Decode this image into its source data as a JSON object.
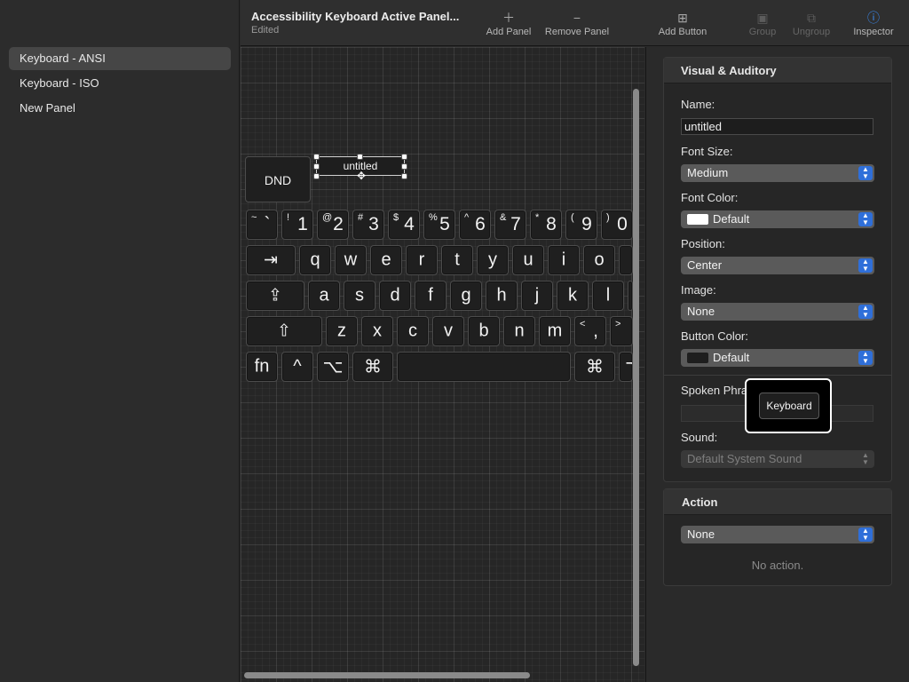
{
  "sidebar": {
    "items": [
      {
        "label": "Keyboard - ANSI",
        "selected": true
      },
      {
        "label": "Keyboard - ISO",
        "selected": false
      },
      {
        "label": "New Panel",
        "selected": false
      }
    ]
  },
  "toolbar": {
    "title": "Accessibility Keyboard Active Panel...",
    "subtitle": "Edited",
    "add_panel": "Add Panel",
    "remove_panel": "Remove Panel",
    "add_button": "Add Button",
    "group": "Group",
    "ungroup": "Ungroup",
    "inspector": "Inspector",
    "icons": {
      "add_panel": "plus-icon",
      "remove_panel": "minus-icon",
      "add_button": "add-button-icon",
      "group": "group-icon",
      "ungroup": "ungroup-icon",
      "inspector": "info-icon"
    },
    "accent_color": "#3b8cf5"
  },
  "canvas": {
    "dnd_label": "DND",
    "selected_button_label": "untitled",
    "row1": [
      {
        "s": "~",
        "m": "`"
      },
      {
        "s": "!",
        "m": "1"
      },
      {
        "s": "@",
        "m": "2"
      },
      {
        "s": "#",
        "m": "3"
      },
      {
        "s": "$",
        "m": "4"
      },
      {
        "s": "%",
        "m": "5"
      },
      {
        "s": "^",
        "m": "6"
      },
      {
        "s": "&",
        "m": "7"
      },
      {
        "s": "*",
        "m": "8"
      },
      {
        "s": "(",
        "m": "9"
      },
      {
        "s": ")",
        "m": "0"
      }
    ],
    "tab": "⇥",
    "row2": [
      "q",
      "w",
      "e",
      "r",
      "t",
      "y",
      "u",
      "i",
      "o",
      ""
    ],
    "caps": "⇪",
    "row3": [
      "a",
      "s",
      "d",
      "f",
      "g",
      "h",
      "j",
      "k",
      "l",
      ""
    ],
    "shift": "⇧",
    "row4": [
      "z",
      "x",
      "c",
      "v",
      "b",
      "n",
      "m"
    ],
    "comma": {
      "s": "<",
      "m": ","
    },
    "period": {
      "s": ">",
      "m": ""
    },
    "row5": {
      "fn": "fn",
      "control": "^",
      "option": "⌥",
      "command": "⌘",
      "space": "",
      "command_right": "⌘",
      "cut": "⌥"
    }
  },
  "inspector": {
    "visual_header": "Visual & Auditory",
    "name_label": "Name:",
    "name_value": "untitled",
    "font_size_label": "Font Size:",
    "font_size_value": "Medium",
    "font_color_label": "Font Color:",
    "font_color_value": "Default",
    "font_color_swatch": "#ffffff",
    "position_label": "Position:",
    "position_value": "Center",
    "image_label": "Image:",
    "image_value": "None",
    "button_color_label": "Button Color:",
    "button_color_value": "Default",
    "button_color_swatch": "#1e1e1e",
    "spoken_label": "Spoken Phra",
    "spoken_value": "",
    "sound_label": "Sound:",
    "sound_value": "Default System Sound",
    "action_header": "Action",
    "action_value": "None",
    "no_action": "No action."
  },
  "tooltip": {
    "label": "Keyboard"
  }
}
